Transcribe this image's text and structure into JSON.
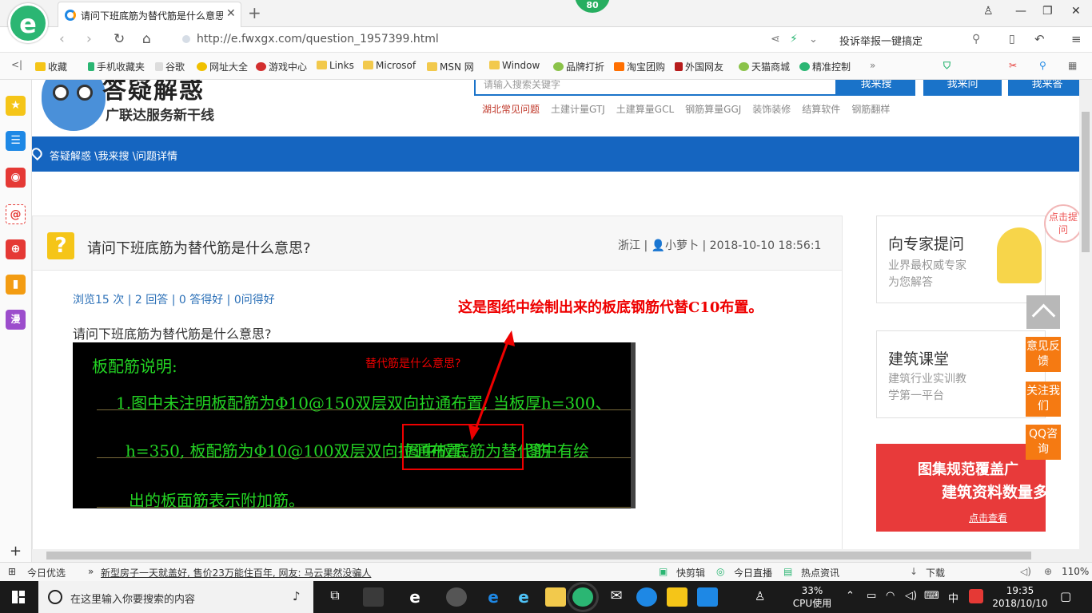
{
  "browser": {
    "tab_title": "请问下班底筋为替代筋是什么意思",
    "score_badge": "80",
    "url": "http://e.fwxgx.com/question_1957399.html",
    "report_link": "投诉举报一键搞定"
  },
  "bookmarks": [
    "收藏",
    "手机收藏夹",
    "谷歌",
    "网址大全",
    "游戏中心",
    "Links",
    "Microsof",
    "MSN 网",
    "Window",
    "品牌打折",
    "淘宝团购",
    "外国网友",
    "天猫商城",
    "精准控制"
  ],
  "site": {
    "title": "答疑解惑",
    "subtitle": "广联达服务新干线",
    "search_placeholder": "请输入搜索关键字",
    "search_buttons": [
      "我来搜",
      "我来问",
      "我来答"
    ],
    "hot_links": [
      "湖北常见问题",
      "土建计量GTJ",
      "土建算量GCL",
      "钢筋算量GGJ",
      "装饰装修",
      "结算软件",
      "钢筋翻样"
    ],
    "breadcrumb": "答疑解惑 \\我来搜 \\问题详情"
  },
  "question": {
    "title": "请问下班底筋为替代筋是什么意思?",
    "meta": "浙江 | 👤小萝卜 | 2018-10-10 18:56:1",
    "stats": "浏览15 次 | 2 回答 | 0 答得好 | 0问得好",
    "body": "请问下班底筋为替代筋是什么意思?",
    "annotation": "这是图纸中绘制出来的板底钢筋代替C10布置。"
  },
  "cad": {
    "heading": "板配筋说明:",
    "red_note": "替代筋是什么意思?",
    "line1": "1.图中未注明板配筋为Φ10@150双层双向拉通布置, 当板厚h=300、",
    "line2a": "h=350, 板配筋为Φ10@100双层双向拉通布置.",
    "line2b": "图中板底筋为替代筋",
    "line2c": "图中有绘",
    "line3": "出的板面筋表示附加筋。"
  },
  "sidebar_right": {
    "expert_title": "向专家提问",
    "expert_sub": [
      "业界最权威专家",
      "为您解答"
    ],
    "expert_badge": "点击提问",
    "course_title": "建筑课堂",
    "course_sub": [
      "建筑行业实训教",
      "学第一平台"
    ],
    "float_buttons": [
      "意见反馈",
      "关注我们",
      "QQ咨询"
    ],
    "banner_line1": "图集规范覆盖广",
    "banner_line2": "建筑资料数量多",
    "banner_link": "点击查看"
  },
  "statusbar": {
    "left": "今日优选",
    "news": "新型房子一天就盖好, 售价23万能住百年, 网友: 马云果然没骗人",
    "items": [
      "快剪辑",
      "今日直播",
      "热点资讯",
      "下载"
    ],
    "zoom": "110%"
  },
  "taskbar": {
    "search_placeholder": "在这里输入你要搜索的内容",
    "cpu_percent": "33%",
    "cpu_label": "CPU使用",
    "ime": "中",
    "time": "19:35",
    "date": "2018/10/10"
  }
}
